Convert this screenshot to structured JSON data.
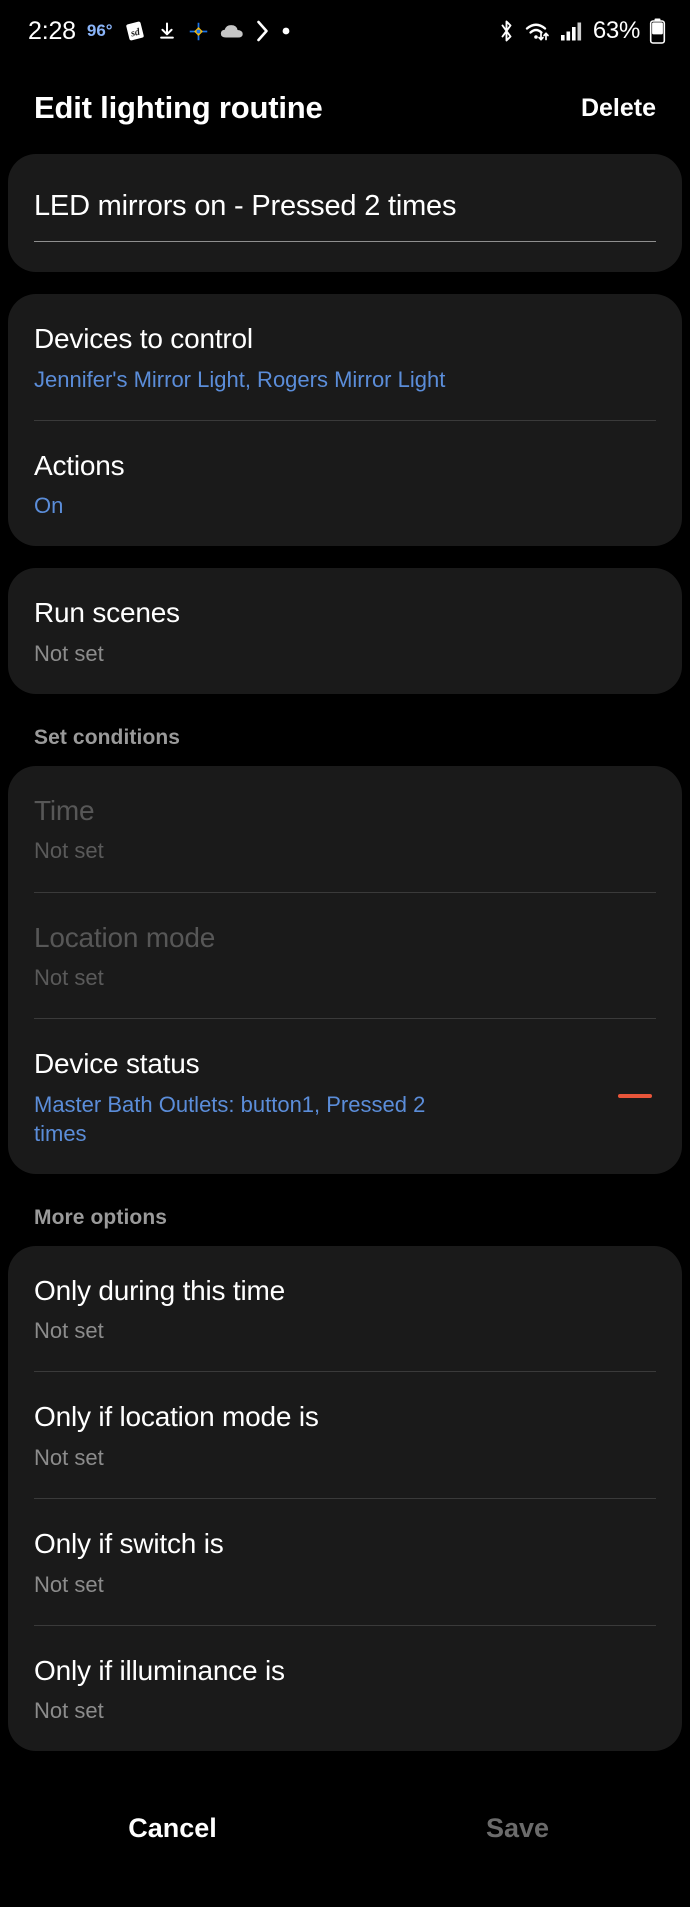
{
  "statusbar": {
    "time": "2:28",
    "temperature": "96°",
    "left_icons": [
      "sd-card-icon",
      "download-icon",
      "pinwheel-icon",
      "cloud-icon",
      "chevron-right-icon",
      "dot-icon"
    ],
    "right_icons": [
      "bluetooth-icon",
      "wifi-icon",
      "cellular-signal-icon"
    ],
    "battery_percent": "63%",
    "battery_icon": "battery-icon"
  },
  "header": {
    "title": "Edit lighting routine",
    "delete_label": "Delete"
  },
  "name_field": {
    "value": "LED mirrors on - Pressed 2 times",
    "placeholder": "Routine name"
  },
  "devices_card": {
    "rows": [
      {
        "title": "Devices to control",
        "sub": "Jennifer's Mirror Light, Rogers Mirror Light",
        "sub_style": "blue"
      },
      {
        "title": "Actions",
        "sub": "On",
        "sub_style": "blue"
      }
    ]
  },
  "scenes_card": {
    "rows": [
      {
        "title": "Run scenes",
        "sub": "Not set",
        "sub_style": "grey"
      }
    ]
  },
  "conditions": {
    "section_label": "Set conditions",
    "rows": [
      {
        "title": "Time",
        "sub": "Not set",
        "sub_style": "grey",
        "disabled": true
      },
      {
        "title": "Location mode",
        "sub": "Not set",
        "sub_style": "grey",
        "disabled": true
      },
      {
        "title": "Device status",
        "sub": "Master Bath Outlets: button1, Pressed 2 times",
        "sub_style": "blue",
        "disabled": false,
        "remove_icon": "minus-icon",
        "remove_color": "#e8553a"
      }
    ]
  },
  "more_options": {
    "section_label": "More options",
    "rows": [
      {
        "title": "Only during this time",
        "sub": "Not set",
        "sub_style": "grey"
      },
      {
        "title": "Only if location mode is",
        "sub": "Not set",
        "sub_style": "grey"
      },
      {
        "title": "Only if switch is",
        "sub": "Not set",
        "sub_style": "grey"
      },
      {
        "title": "Only if illuminance is",
        "sub": "Not set",
        "sub_style": "grey"
      }
    ]
  },
  "bottombar": {
    "cancel_label": "Cancel",
    "save_label": "Save"
  },
  "colors": {
    "accent_blue": "#5b8dd9",
    "card_bg": "#1a1a1a",
    "page_bg": "#000000",
    "remove_orange": "#e8553a",
    "status_temp_blue": "#8ab4f8"
  }
}
